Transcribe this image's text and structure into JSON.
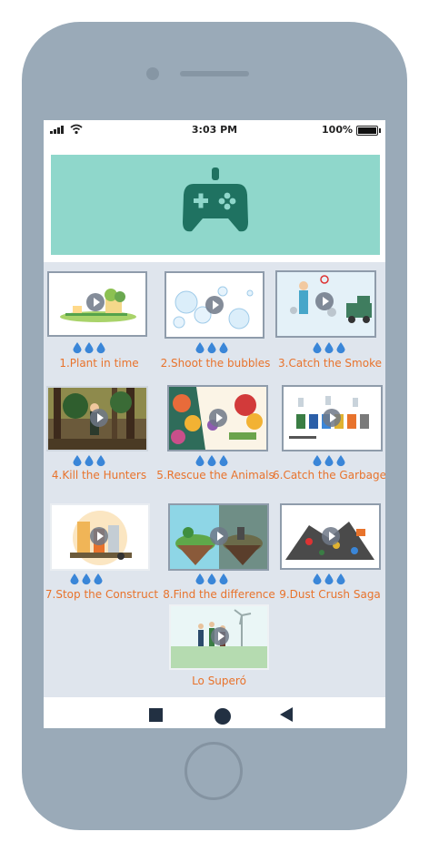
{
  "status_bar": {
    "time": "3:03 PM",
    "battery_percent": "100%"
  },
  "banner": {
    "icon": "gamepad-icon",
    "color": "#8fd7cb",
    "icon_color": "#1f7261"
  },
  "games": [
    {
      "label": "1.Plant in time",
      "drops": 3
    },
    {
      "label": "2.Shoot the bubbles",
      "drops": 3
    },
    {
      "label": "3.Catch the Smoke",
      "drops": 3
    },
    {
      "label": "4.Kill the Hunters",
      "drops": 3
    },
    {
      "label": "5.Rescue the Animals",
      "drops": 3
    },
    {
      "label": "6.Catch the Garbage",
      "drops": 3
    },
    {
      "label": "7.Stop the Construct",
      "drops": 3
    },
    {
      "label": "8.Find the difference",
      "drops": 3
    },
    {
      "label": "9.Dust Crush Saga",
      "drops": 3
    },
    {
      "label": "Lo Superó",
      "drops": 0
    }
  ],
  "nav": {
    "recent_icon": "square-icon",
    "home_icon": "circle-icon",
    "back_icon": "back-triangle-icon"
  },
  "colors": {
    "label": "#e8732c",
    "drop": "#3a86d8",
    "background": "#dfe5ed",
    "phone": "#9aaab8"
  }
}
